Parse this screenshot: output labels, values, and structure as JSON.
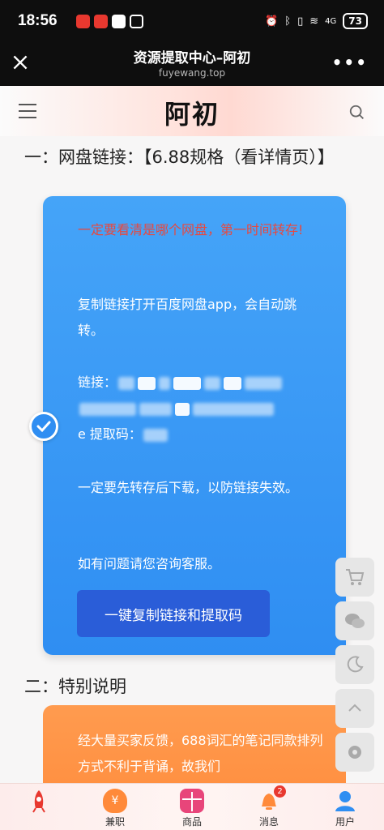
{
  "status": {
    "time": "18:56",
    "battery": "73",
    "signal_label": "4G"
  },
  "browser": {
    "title": "资源提取中心–阿初",
    "domain": "fuyewang.top"
  },
  "site": {
    "logo": "阿初"
  },
  "section1": {
    "title": "一：网盘链接：【6.88规格（看详情页）】"
  },
  "card": {
    "warning": "一定要看清是哪个网盘，第一时间转存!",
    "instruction": "复制链接打开百度网盘app，会自动跳转。",
    "link_label": "链接：",
    "code_label": "e 提取码：",
    "tip": "一定要先转存后下载，以防链接失效。",
    "help": "如有问题请您咨询客服。",
    "copy_button": "一键复制链接和提取码"
  },
  "section2": {
    "title": "二：特别说明"
  },
  "notice": {
    "text": "经大量买家反馈，688词汇的笔记同款排列方式不利于背诵，故我们"
  },
  "bottom_nav": {
    "items": [
      {
        "label": "",
        "icon": "rocket-icon"
      },
      {
        "label": "兼职",
        "icon": "money-bag-icon"
      },
      {
        "label": "商品",
        "icon": "gift-icon"
      },
      {
        "label": "消息",
        "icon": "bell-icon",
        "badge": "2"
      },
      {
        "label": "用户",
        "icon": "user-icon"
      }
    ]
  },
  "colors": {
    "accent_blue": "#2f8ef2",
    "button_blue": "#2a5dd8",
    "warning_red": "#e8483e",
    "notice_orange": "#ff8a3a",
    "badge_red": "#e8382f"
  }
}
